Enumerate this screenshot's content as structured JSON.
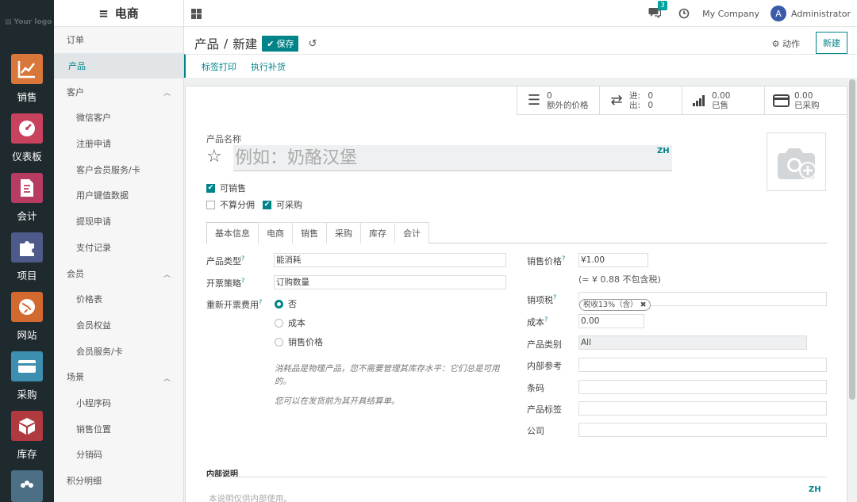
{
  "rail": {
    "logo": "Your logo",
    "apps": [
      {
        "label": "销售",
        "icon": "sales-chart-icon",
        "color": "#d9763a"
      },
      {
        "label": "仪表板",
        "icon": "dashboard-gauge-icon",
        "color": "#c9425d"
      },
      {
        "label": "会计",
        "icon": "accounting-doc-icon",
        "color": "#b63c62"
      },
      {
        "label": "项目",
        "icon": "project-puzzle-icon",
        "color": "#4d5a8a"
      },
      {
        "label": "网站",
        "icon": "website-globe-icon",
        "color": "#d2692e"
      },
      {
        "label": "采购",
        "icon": "purchase-card-icon",
        "color": "#3d8fb0"
      },
      {
        "label": "库存",
        "icon": "inventory-box-icon",
        "color": "#b03a3f"
      },
      {
        "label": "",
        "icon": "team-icon",
        "color": "#4c6f86"
      }
    ]
  },
  "sidebar": {
    "title": "电商",
    "items": [
      {
        "label": "订单",
        "level": 0
      },
      {
        "label": "产品",
        "level": 0,
        "active": true
      },
      {
        "label": "客户",
        "level": 0,
        "expandable": true
      },
      {
        "label": "微信客户",
        "level": 1
      },
      {
        "label": "注册申请",
        "level": 1
      },
      {
        "label": "客户会员服务/卡",
        "level": 1
      },
      {
        "label": "用户键值数据",
        "level": 1
      },
      {
        "label": "提现申请",
        "level": 1
      },
      {
        "label": "支付记录",
        "level": 1
      },
      {
        "label": "会员",
        "level": 0,
        "expandable": true
      },
      {
        "label": "价格表",
        "level": 1
      },
      {
        "label": "会员权益",
        "level": 1
      },
      {
        "label": "会员服务/卡",
        "level": 1
      },
      {
        "label": "场景",
        "level": 0,
        "expandable": true
      },
      {
        "label": "小程序码",
        "level": 1
      },
      {
        "label": "销售位置",
        "level": 1
      },
      {
        "label": "分销码",
        "level": 1
      },
      {
        "label": "积分明细",
        "level": 0
      }
    ]
  },
  "topbar": {
    "messages_count": "3",
    "company": "My Company",
    "avatar_letter": "A",
    "user": "Administrator"
  },
  "control": {
    "breadcrumb_parent": "产品",
    "breadcrumb_sep": "/",
    "breadcrumb_current": "新建",
    "save_label": "保存",
    "actions_label": "动作",
    "new_label": "新建",
    "tabs": [
      "标签打印",
      "执行补货"
    ]
  },
  "stats": [
    {
      "icon": "list-icon",
      "value": "0",
      "label": "额外的价格"
    },
    {
      "icon": "transfer-icon",
      "in_label": "进:",
      "in_value": "0",
      "out_label": "出:",
      "out_value": "0"
    },
    {
      "icon": "bar-signal-icon",
      "value": "0.00",
      "label": "已售"
    },
    {
      "icon": "credit-card-icon",
      "value": "0.00",
      "label": "已采购"
    }
  ],
  "form": {
    "name_label": "产品名称",
    "name_placeholder": "例如：奶酪汉堡",
    "lang": "ZH",
    "checks": {
      "can_sell": {
        "label": "可销售",
        "checked": true
      },
      "no_commission": {
        "label": "不算分佣",
        "checked": false
      },
      "can_purchase": {
        "label": "可采购",
        "checked": true
      }
    },
    "tabs": [
      "基本信息",
      "电商",
      "销售",
      "采购",
      "库存",
      "会计"
    ],
    "left": {
      "product_type_label": "产品类型",
      "product_type_value": "能消耗",
      "invoice_policy_label": "开票策略",
      "invoice_policy_value": "订购数量",
      "reinvoice_label": "重新开票费用",
      "reinvoice_options": [
        "否",
        "成本",
        "销售价格"
      ],
      "note1": "消耗品是物理产品，您不需要管理其库存水平：它们总是可用的。",
      "note2": "您可以在发货前为其开具结算单。"
    },
    "right": {
      "sale_price_label": "销售价格",
      "sale_price_value": "¥1.00",
      "sale_price_note": "(= ¥ 0.88 不包含税)",
      "sale_tax_label": "销项税",
      "sale_tax_tag": "税收13%（含）",
      "cost_label": "成本",
      "cost_value": "0.00",
      "category_label": "产品类别",
      "category_value": "All",
      "internal_ref_label": "内部参考",
      "barcode_label": "条码",
      "tags_label": "产品标签",
      "company_label": "公司"
    },
    "internal_notes_label": "内部说明",
    "internal_notes_placeholder": "本说明仅供内部使用。"
  },
  "colors": {
    "accent": "#00848a",
    "rail": "#1f2a2e"
  }
}
